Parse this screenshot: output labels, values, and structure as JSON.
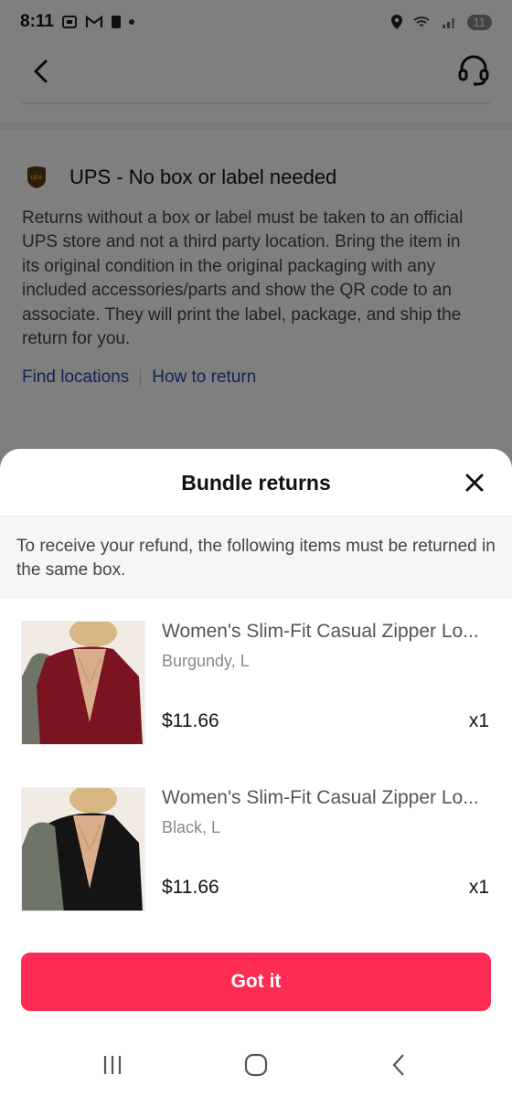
{
  "status_bar": {
    "time": "8:11",
    "battery": "11"
  },
  "background": {
    "ups": {
      "title": "UPS - No box or label needed",
      "description": "Returns without a box or label must be taken to an official UPS store and not a third party location. Bring the item in its original condition in the original packaging with any included accessories/parts and show the QR code to an associate. They will print the label, package, and ship the return for you.",
      "links": [
        "Find locations",
        "How to return"
      ]
    }
  },
  "sheet": {
    "title": "Bundle returns",
    "notice": "To receive your refund, the following items must be returned in the same box.",
    "items": [
      {
        "title": "Women's Slim-Fit Casual Zipper Lo...",
        "variant": "Burgundy, L",
        "price": "$11.66",
        "qty": "x1",
        "garment_color": "#7a1420"
      },
      {
        "title": "Women's Slim-Fit Casual Zipper Lo...",
        "variant": "Black, L",
        "price": "$11.66",
        "qty": "x1",
        "garment_color": "#141414"
      }
    ],
    "button_label": "Got it"
  },
  "colors": {
    "accent": "#fe2c55",
    "link": "#1e4aa8",
    "ups_brown": "#5a3a14",
    "ups_gold": "#f5b800"
  }
}
